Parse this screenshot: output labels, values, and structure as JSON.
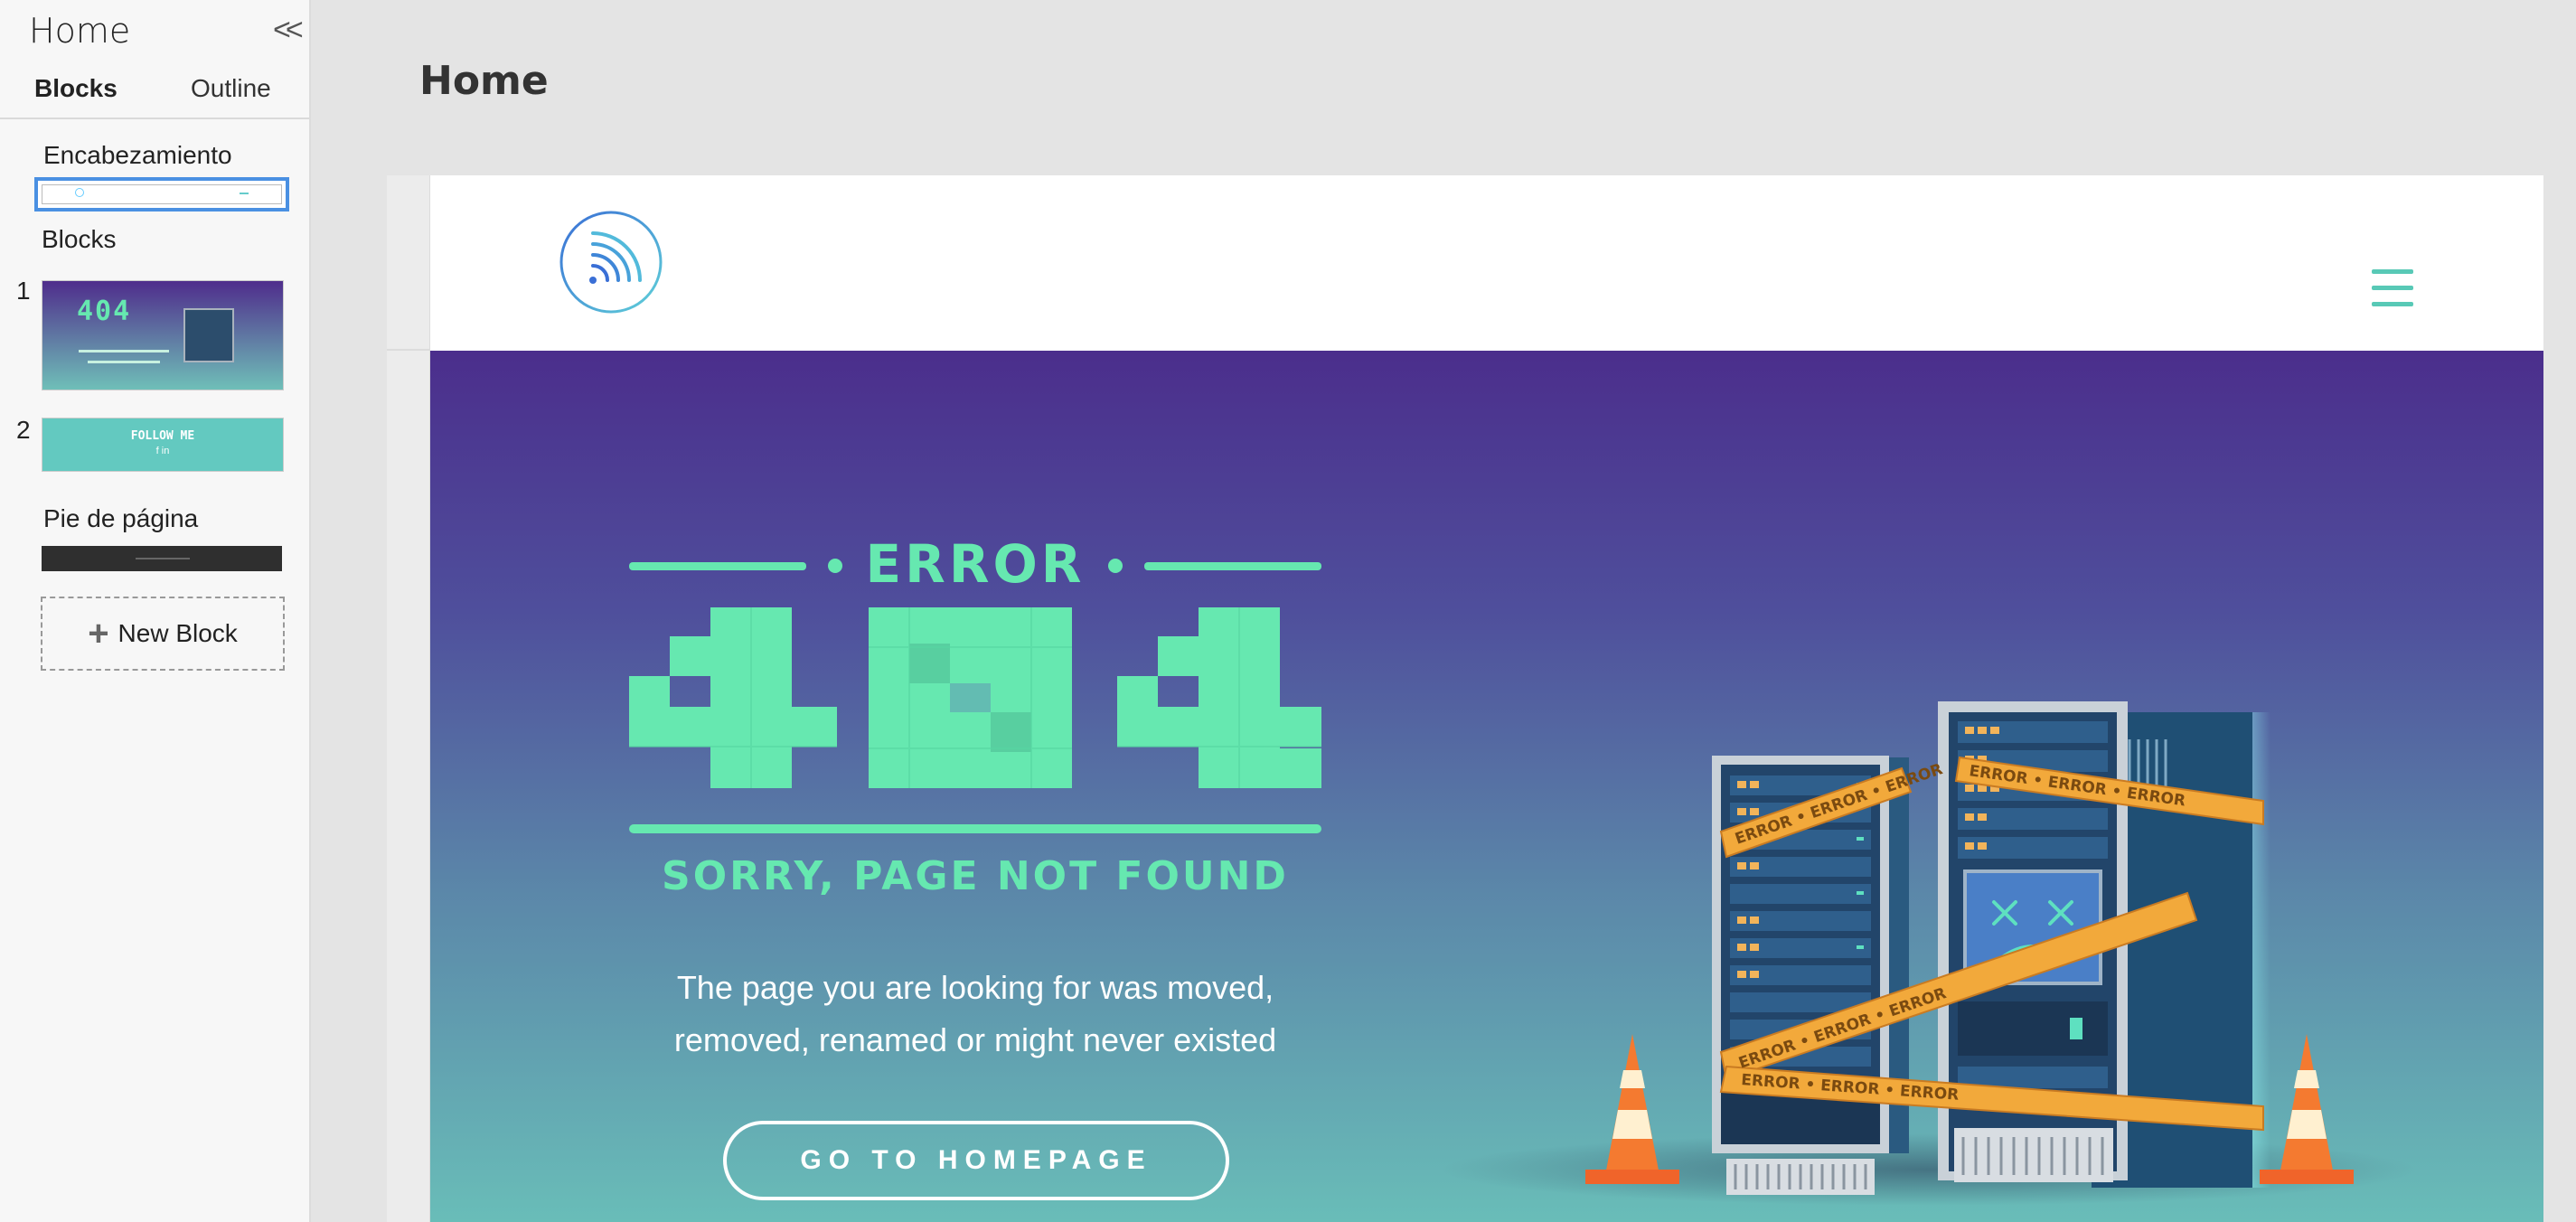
{
  "sidebar": {
    "title": "Home",
    "collapse_icon": "double-chevron-left-icon",
    "collapse_glyph": "<<",
    "tabs": [
      {
        "label": "Blocks",
        "active": true
      },
      {
        "label": "Outline",
        "active": false
      }
    ],
    "header_section_label": "Encabezamiento",
    "blocks_section_label": "Blocks",
    "blocks": [
      {
        "number": "1",
        "thumb_big": "404"
      },
      {
        "number": "2",
        "thumb_title": "FOLLOW ME",
        "thumb_icons": "f in"
      }
    ],
    "footer_section_label": "Pie de página",
    "new_block_label": "New Block",
    "new_block_icon": "plus-icon"
  },
  "main": {
    "page_title": "Home"
  },
  "site": {
    "logo_icon": "wifi-signal-logo-icon",
    "menu_icon": "hamburger-menu-icon",
    "accent_color": "#66e8b0",
    "menu_color": "#58c9b6",
    "hero": {
      "error_label": "ERROR",
      "code": "404",
      "subtitle": "SORRY, PAGE NOT FOUND",
      "desc_line1": "The page you are looking for was moved,",
      "desc_line2": "removed, renamed or might never existed",
      "button_label": "GO TO HOMEPAGE",
      "tape_text": "ERROR • ERROR • ERROR",
      "gradient_top": "#4b2e8c",
      "gradient_bottom": "#69bdb8"
    }
  }
}
